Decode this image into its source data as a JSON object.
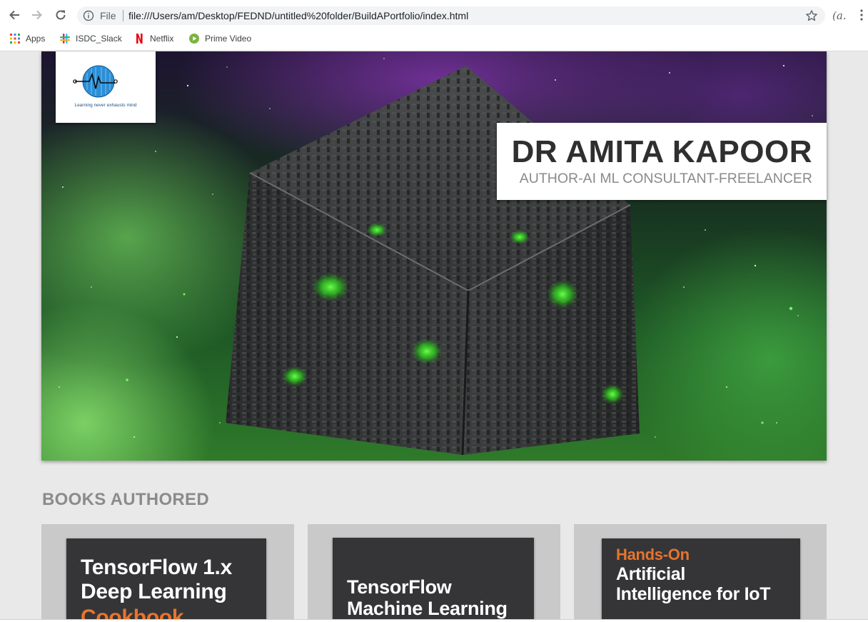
{
  "browser": {
    "omnibox": {
      "scheme_label": "File",
      "url": "file:///Users/am/Desktop/FEDND/untitled%20folder/BuildAPortfolio/index.html"
    },
    "profile_label": "(a.",
    "bookmarks": [
      {
        "label": "Apps",
        "icon": "apps-grid-icon"
      },
      {
        "label": "ISDC_Slack",
        "icon": "slack-icon"
      },
      {
        "label": "Netflix",
        "icon": "netflix-icon"
      },
      {
        "label": "Prime Video",
        "icon": "prime-video-icon"
      }
    ]
  },
  "hero": {
    "logo_tagline": "Learning never exhausts mind",
    "name": "DR AMITA KAPOOR",
    "role": "AUTHOR-AI ML CONSULTANT-FREELANCER"
  },
  "books": {
    "section_title": "BOOKS AUTHORED",
    "items": [
      {
        "lines": [
          "TensorFlow 1.x",
          "Deep Learning",
          "Cookbook"
        ]
      },
      {
        "lines": [
          "TensorFlow",
          "Machine Learning"
        ]
      },
      {
        "lines": [
          "Hands-On",
          "Artificial",
          "Intelligence for IoT"
        ]
      }
    ]
  },
  "colors": {
    "page_bg": "#e9e9e9",
    "card_bg": "#c9c9c9",
    "book_cover": "#353537",
    "accent_orange": "#e8742c",
    "heading_gray": "#8b8b8b",
    "name_text": "#2f2f2f"
  }
}
